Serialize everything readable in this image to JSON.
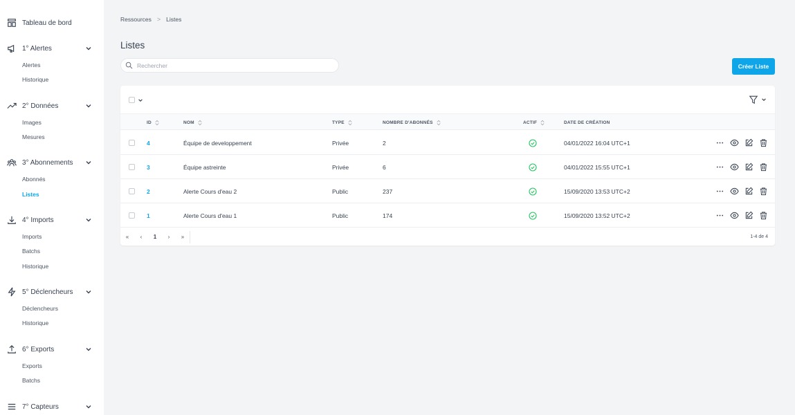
{
  "sidebar": {
    "dashboard": "Tableau de bord",
    "groups": [
      {
        "label": "1° Alertes",
        "icon": "megaphone-icon",
        "items": [
          "Alertes",
          "Historique"
        ]
      },
      {
        "label": "2° Données",
        "icon": "trend-icon",
        "items": [
          "Images",
          "Mesures"
        ]
      },
      {
        "label": "3° Abonnements",
        "icon": "users-icon",
        "items": [
          "Abonnés",
          "Listes"
        ]
      },
      {
        "label": "4° Imports",
        "icon": "download-icon",
        "items": [
          "Imports",
          "Batchs",
          "Historique"
        ]
      },
      {
        "label": "5° Déclencheurs",
        "icon": "lightning-icon",
        "items": [
          "Déclencheurs",
          "Historique"
        ]
      },
      {
        "label": "6° Exports",
        "icon": "upload-icon",
        "items": [
          "Exports",
          "Batchs"
        ]
      },
      {
        "label": "7° Capteurs",
        "icon": "menu-icon",
        "items": []
      }
    ],
    "active_item": "Listes"
  },
  "breadcrumb": {
    "root": "Ressources",
    "separator": ">",
    "current": "Listes"
  },
  "page": {
    "title": "Listes"
  },
  "search": {
    "placeholder": "Rechercher",
    "value": ""
  },
  "create_button": "Créer Liste",
  "table": {
    "columns": {
      "id": "ID",
      "nom": "NOM",
      "type": "TYPE",
      "abonnes": "NOMBRE D'ABONNÉS",
      "actif": "ACTIF",
      "date": "DATE DE CRÉATION"
    },
    "rows": [
      {
        "id": "4",
        "nom": "Équipe de developpement",
        "type": "Privée",
        "abonnes": "2",
        "actif": true,
        "date": "04/01/2022 16:04 UTC+1"
      },
      {
        "id": "3",
        "nom": "Équipe astreinte",
        "type": "Privée",
        "abonnes": "6",
        "actif": true,
        "date": "04/01/2022 15:55 UTC+1"
      },
      {
        "id": "2",
        "nom": "Alerte Cours d'eau 2",
        "type": "Public",
        "abonnes": "237",
        "actif": true,
        "date": "15/09/2020 13:53 UTC+2"
      },
      {
        "id": "1",
        "nom": "Alerte Cours d'eau 1",
        "type": "Public",
        "abonnes": "174",
        "actif": true,
        "date": "15/09/2020 13:52 UTC+2"
      }
    ],
    "actions": [
      "more-icon",
      "eye-icon",
      "edit-icon",
      "trash-icon"
    ]
  },
  "pagination": {
    "first": "«",
    "prev": "‹",
    "current": "1",
    "next": "›",
    "last": "»",
    "info": "1-4 de 4"
  },
  "colors": {
    "accent": "#0ea5e9",
    "success": "#22c55e",
    "background": "#f3f4f6"
  }
}
